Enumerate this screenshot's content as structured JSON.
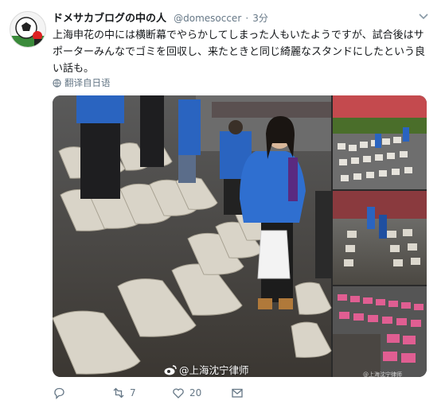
{
  "tweet": {
    "display_name": "ドメサカブログの中の人",
    "handle": "@domesoccer",
    "separator": "·",
    "time": "3分",
    "text": "上海申花の中には横断幕でやらかしてしまった人もいたようですが、試合後はサポーターみんなでゴミを回収し、来たときと同じ綺麗なスタンドにしたという良い話も。",
    "translate_label": "翻译自日语",
    "image_watermark": "@上海沈宁律师",
    "image_small_watermark": "@上海沈宁律师",
    "actions": {
      "reply_count": "",
      "retweet_count": "7",
      "like_count": "20"
    }
  },
  "icons": {
    "more": "chevron-down-icon",
    "translate": "globe-icon",
    "reply": "reply-icon",
    "retweet": "retweet-icon",
    "like": "heart-icon",
    "message": "envelope-icon",
    "watermark": "weibo-logo-icon"
  },
  "colors": {
    "text": "#14171a",
    "secondary": "#657786",
    "seat": "#d9d4c8",
    "jacket": "#2a64c0",
    "red_seats": "#c44a4e",
    "pink_seats": "#e05e92"
  }
}
